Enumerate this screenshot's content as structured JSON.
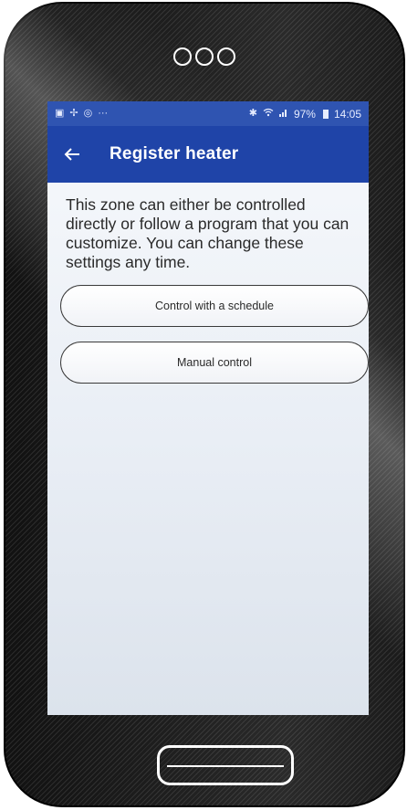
{
  "status_bar": {
    "left_icons": [
      "image-icon",
      "sync-icon",
      "notification-icon",
      "more-icon"
    ],
    "bluetooth_icon": "bluetooth-icon",
    "wifi_icon": "wifi-icon",
    "signal_icon": "signal-icon",
    "battery_percent": "97%",
    "time": "14:05"
  },
  "app_bar": {
    "back_icon": "back-arrow-icon",
    "title": "Register heater"
  },
  "content": {
    "intro_text": "This zone can either be controlled directly or follow a program that you can customize. You can change these settings any time.",
    "option_schedule_label": "Control with a schedule",
    "option_manual_label": "Manual control"
  },
  "colors": {
    "status_bar": "#2f54b1",
    "app_bar": "#1f44a8",
    "screen_bg": "#eef2f7",
    "phone_body": "#1a1a1a"
  }
}
